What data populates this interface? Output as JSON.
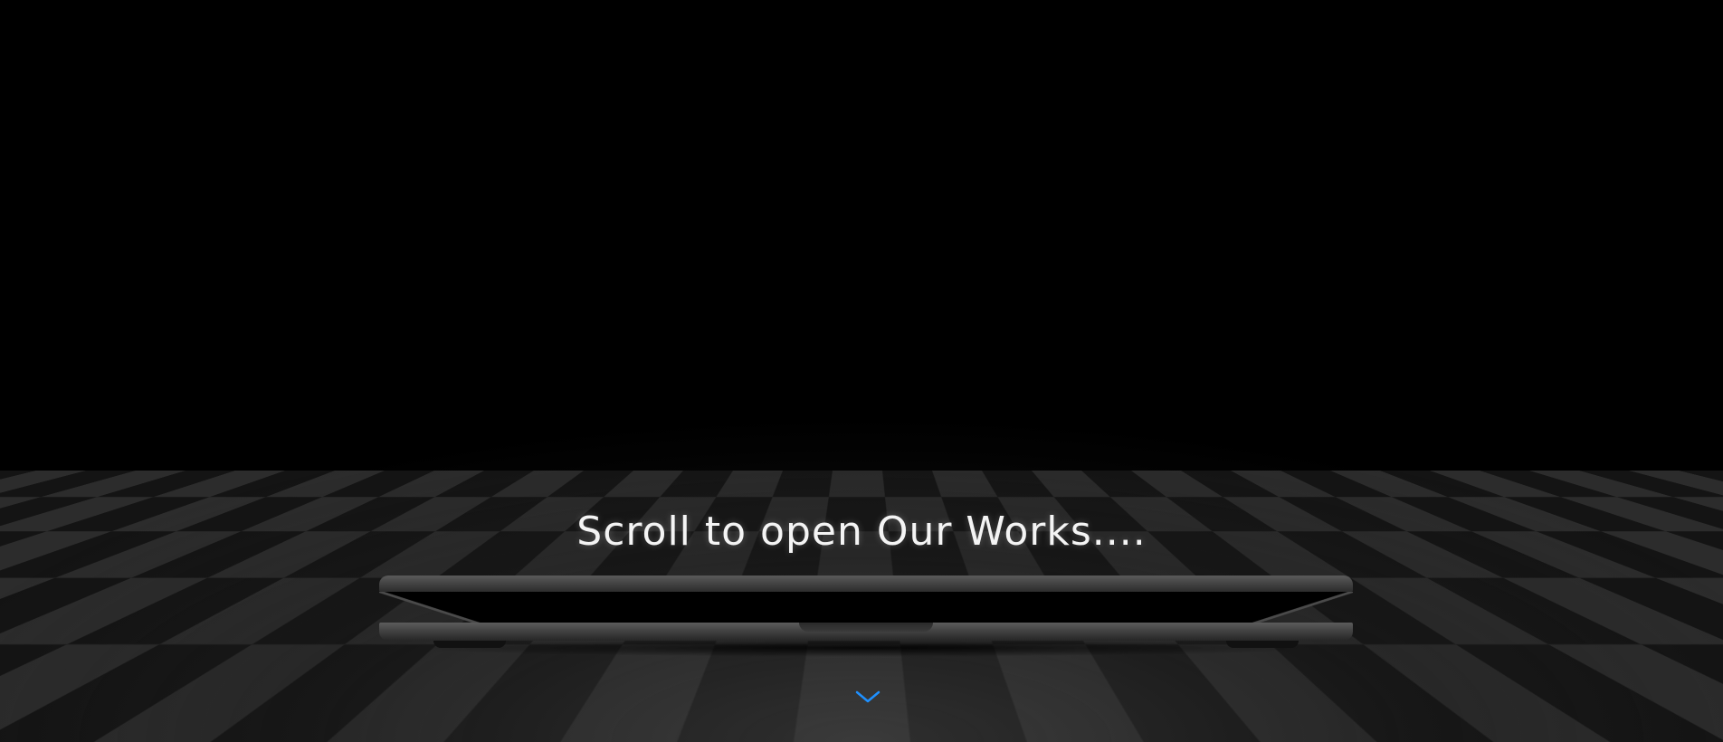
{
  "hero": {
    "headline": "Scroll to open Our Works....",
    "scroll_icon": "chevron-down-icon"
  },
  "colors": {
    "background": "#000000",
    "text": "#f4f4f4",
    "accent": "#1e90ff",
    "laptop_body": "#3e3e3e"
  }
}
